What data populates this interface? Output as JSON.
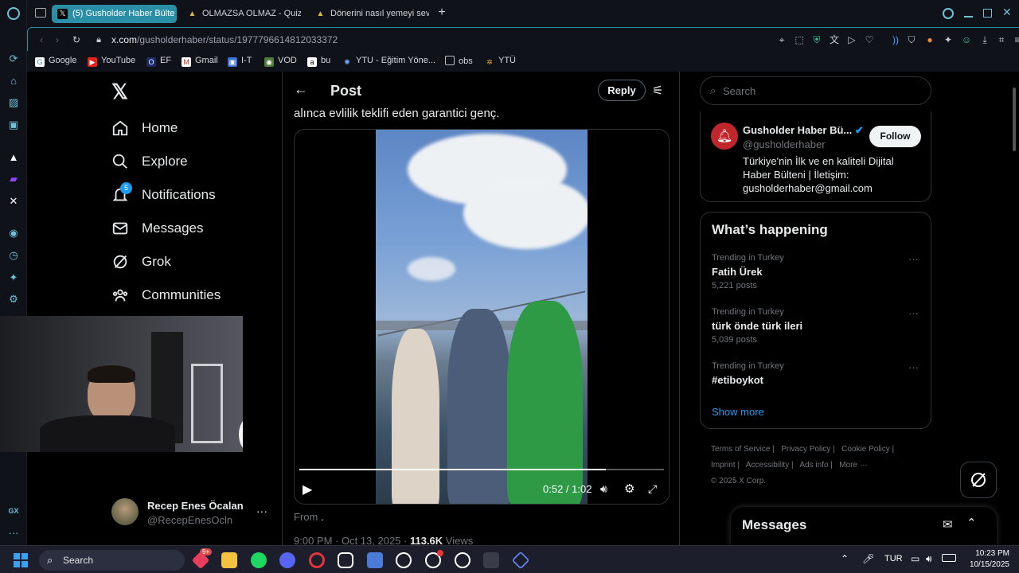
{
  "browser": {
    "tabs": [
      {
        "label": "(5) Gusholder Haber Bülte",
        "active": true
      },
      {
        "label": "OLMAZSA OLMAZ - Quiz",
        "active": false
      },
      {
        "label": "Dönerini nasıl yemeyi sev",
        "active": false
      }
    ],
    "url_host": "x.com",
    "url_path": "/gusholderhaber/status/1977796614812033372",
    "bookmarks": [
      "Google",
      "YouTube",
      "EF",
      "Gmail",
      "I-T",
      "VOD",
      "bu",
      "YTU - Eğitim Yöne...",
      "obs",
      "YTÜ"
    ],
    "sidebar_label": "GX"
  },
  "nav": {
    "items": [
      "Home",
      "Explore",
      "Notifications",
      "Messages",
      "Grok",
      "Communities"
    ],
    "notifications_badge": "5",
    "user_name": "Recep Enes Öcalan",
    "user_handle": "@RecepEnesOcln"
  },
  "post": {
    "header_title": "Post",
    "reply_label": "Reply",
    "text_fragment": "alınca evlilik teklifi eden garantici genç.",
    "video_time": "0:52 / 1:02",
    "video_progress": 0.84,
    "from_label": "From",
    "from_value": ".",
    "meta": "9:00 PM · Oct 13, 2025 · ",
    "views_count": "113.6K",
    "views_label": " Views"
  },
  "right": {
    "search_placeholder": "Search",
    "profile": {
      "name": "Gusholder Haber Bü...",
      "handle": "@gusholderhaber",
      "bio": "Türkiye'nin İlk ve en kaliteli Dijital Haber Bülteni | İletişim: gusholderhaber@gmail.com",
      "follow_label": "Follow"
    },
    "happening_title": "What’s happening",
    "trends": [
      {
        "context": "Trending in Turkey",
        "title": "Fatih Ürek",
        "count": "5,221 posts"
      },
      {
        "context": "Trending in Turkey",
        "title": "türk önde türk ileri",
        "count": "5,039 posts"
      },
      {
        "context": "Trending in Turkey",
        "title": "#etiboykot",
        "count": ""
      }
    ],
    "show_more": "Show more",
    "footer_links": [
      "Terms of Service",
      "Privacy Policy",
      "Cookie Policy",
      "Imprint",
      "Accessibility",
      "Ads info",
      "More ···"
    ],
    "copyright": "© 2025 X Corp.",
    "messages_title": "Messages"
  },
  "taskbar": {
    "search_label": "Search",
    "lang": "TUR",
    "time": "10:23 PM",
    "date": "10/15/2025",
    "badge": "9+"
  },
  "colors": {
    "accent": "#1d9bf0",
    "opera_teal": "#2a8fa6",
    "follow_bg": "#eff3f4"
  }
}
